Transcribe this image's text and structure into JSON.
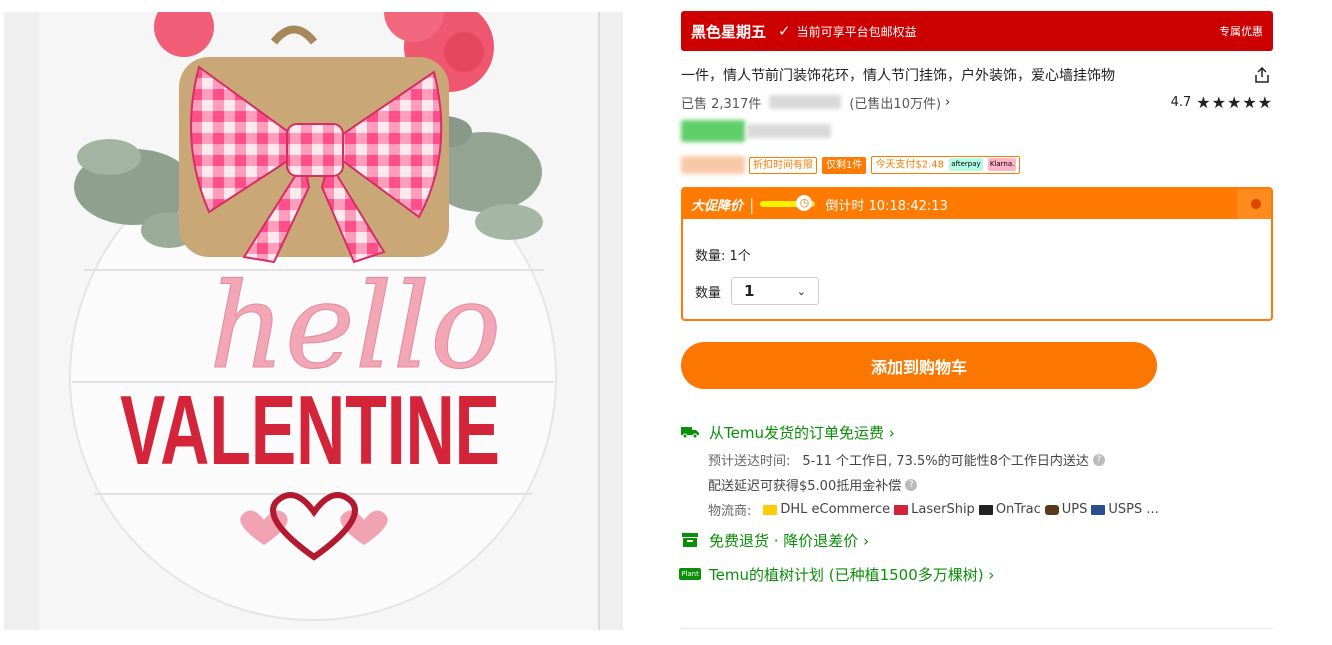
{
  "image": {
    "hello_text": "hello",
    "valentine_text": "VALENTINE"
  },
  "promo": {
    "title": "黑色星期五",
    "check_icon": "check-icon",
    "subtitle": "当前可享平台包邮权益",
    "right_label": "专属优惠"
  },
  "product": {
    "title": "一件，情人节前门装饰花环，情人节门挂饰，户外装饰，爱心墙挂饰物",
    "share_icon": "share-icon"
  },
  "sales": {
    "sold_prefix": "已售 2,317件",
    "sold_total": "(已售出10万件)",
    "chevron": "›",
    "rating": "4.7",
    "stars": "★★★★★"
  },
  "tags": {
    "discount_limited": "折扣时间有限",
    "only_left": "仅剩1件",
    "pay_today": "今天支付$2.48",
    "afterpay": "afterpay",
    "klarna": "Klarna."
  },
  "flash": {
    "label": "大促降价",
    "separator": "|",
    "progress_fraction": 0.8,
    "countdown": "倒计时 10:18:42:13"
  },
  "quantity": {
    "summary": "数量: 1个",
    "label": "数量",
    "selected": "1"
  },
  "cart": {
    "button_label": "添加到购物车"
  },
  "shipping": {
    "free_ship": "从Temu发货的订单免运费 ›",
    "eta_label": "预计送达时间:",
    "eta_value": "5-11 个工作日, 73.5%的可能性8个工作日内送达",
    "delay_comp": "配送延迟可获得$5.00抵用金补偿",
    "carriers_label": "物流商:",
    "carriers": [
      "DHL eCommerce",
      "LaserShip",
      "OnTrac",
      "UPS",
      "USPS ..."
    ],
    "free_return": "免费退货 · 降价退差价 ›",
    "tree_plan": "Temu的植树计划 (已种植1500多万棵树) ›",
    "plant_badge": "Plant"
  },
  "colors": {
    "promo_red": "#cc0000",
    "accent_orange": "#fb7701",
    "green": "#0a8f08"
  }
}
